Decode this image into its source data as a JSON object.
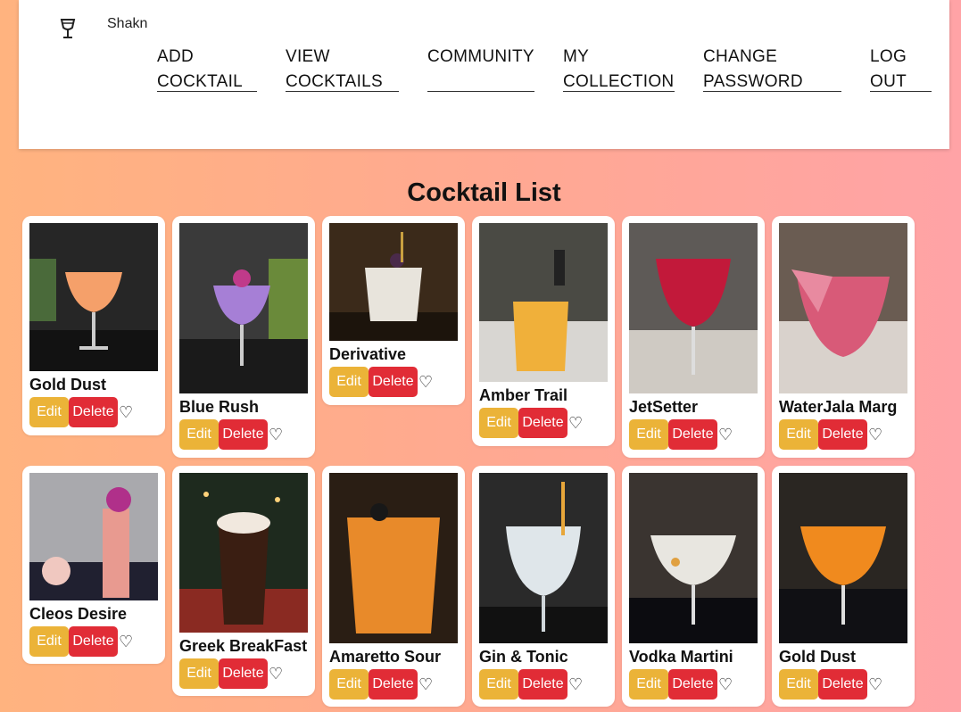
{
  "brand": {
    "name": "Shakn",
    "icon": "cocktail-glass-icon"
  },
  "nav": {
    "add_cocktail": "ADD\nCOCKTAIL",
    "view_cocktails": "VIEW\nCOCKTAILS",
    "community": "COMMUNITY",
    "my_collection": "MY\nCOLLECTION",
    "change_password": "CHANGE\nPASSWORD",
    "log_out": "LOG\nOUT"
  },
  "page_title": "Cocktail List",
  "actions": {
    "edit": "Edit",
    "delete": "Delete",
    "favorite": "♡"
  },
  "colors": {
    "edit": "#ebb338",
    "delete": "#e12c36"
  },
  "cocktails": [
    {
      "name": "Gold Dust"
    },
    {
      "name": "Blue Rush"
    },
    {
      "name": "Derivative"
    },
    {
      "name": "Amber Trail"
    },
    {
      "name": "JetSetter"
    },
    {
      "name": "WaterJala Marg"
    },
    {
      "name": "Cleos Desire"
    },
    {
      "name": "Greek BreakFast"
    },
    {
      "name": "Amaretto Sour"
    },
    {
      "name": "Gin & Tonic"
    },
    {
      "name": "Vodka Martini"
    },
    {
      "name": "Gold Dust"
    }
  ]
}
